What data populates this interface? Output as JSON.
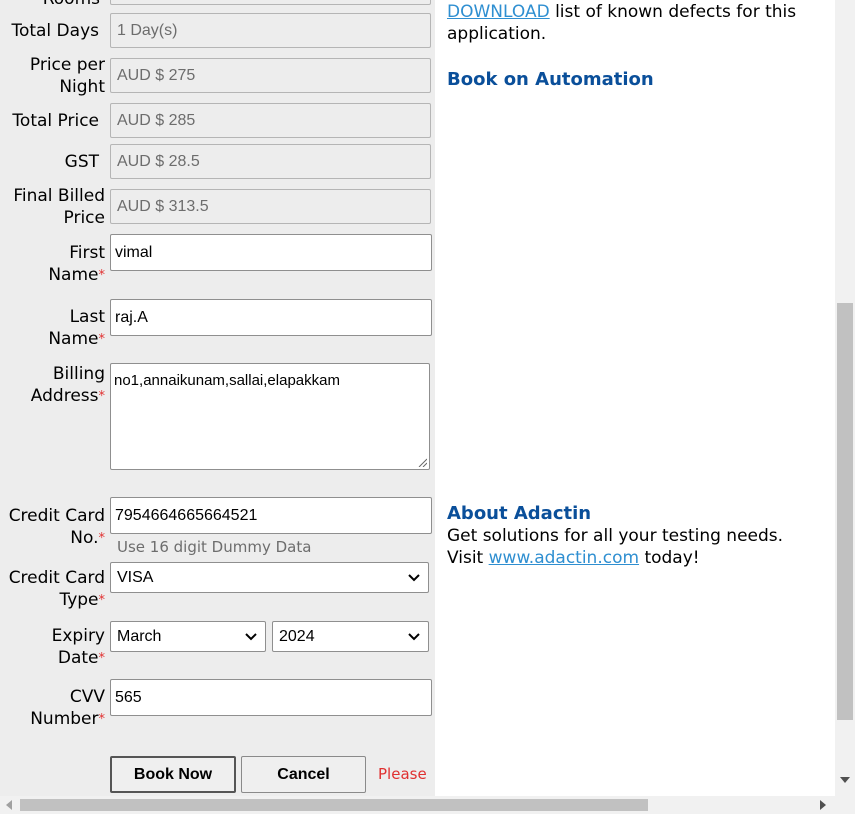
{
  "form": {
    "rooms_label_partial": "Rooms",
    "total_days": {
      "label": "Total Days",
      "value": "1 Day(s)"
    },
    "price_per_night": {
      "label_line1": "Price per",
      "label_line2": "Night",
      "value": "AUD $ 275"
    },
    "total_price": {
      "label": "Total Price",
      "value": "AUD $ 285"
    },
    "gst": {
      "label": "GST",
      "value": "AUD $ 28.5"
    },
    "final_billed_price": {
      "label_line1": "Final Billed",
      "label_line2": "Price",
      "value": "AUD $ 313.5"
    },
    "first_name": {
      "label_line1": "First",
      "label_line2": "Name",
      "value": "vimal"
    },
    "last_name": {
      "label_line1": "Last",
      "label_line2": "Name",
      "value": "raj.A"
    },
    "billing_address": {
      "label_line1": "Billing",
      "label_line2": "Address",
      "value": "no1,annaikunam,sallai,elapakkam"
    },
    "credit_card_no": {
      "label_line1": "Credit Card",
      "label_line2": "No.",
      "value": "7954664665664521",
      "hint": "Use 16 digit Dummy Data"
    },
    "credit_card_type": {
      "label_line1": "Credit Card",
      "label_line2": "Type",
      "selected": "VISA"
    },
    "expiry_date": {
      "label_line1": "Expiry",
      "label_line2": "Date",
      "month_selected": "March",
      "year_selected": "2024"
    },
    "cvv": {
      "label_line1": "CVV",
      "label_line2": "Number",
      "value": "565"
    },
    "required_marker": "*",
    "book_now_label": "Book Now",
    "cancel_label": "Cancel",
    "please_text": "Please"
  },
  "sidebar": {
    "download_link": "DOWNLOAD",
    "download_text_1": " list of known defects for this",
    "download_text_2": "application.",
    "book_heading": "Book on Automation",
    "about_heading": "About Adactin",
    "about_text": "Get solutions for all your testing needs.",
    "visit_prefix": "Visit ",
    "visit_link": "www.adactin.com",
    "visit_suffix": " today!"
  },
  "icons": [
    "chevron-down-icon",
    "resize-grip-icon",
    "scroll-arrow-icon"
  ],
  "colors": {
    "required": "#e03030",
    "heading": "#0a4f9a",
    "link": "#2f8fd1",
    "panel_bg": "#ededed"
  }
}
